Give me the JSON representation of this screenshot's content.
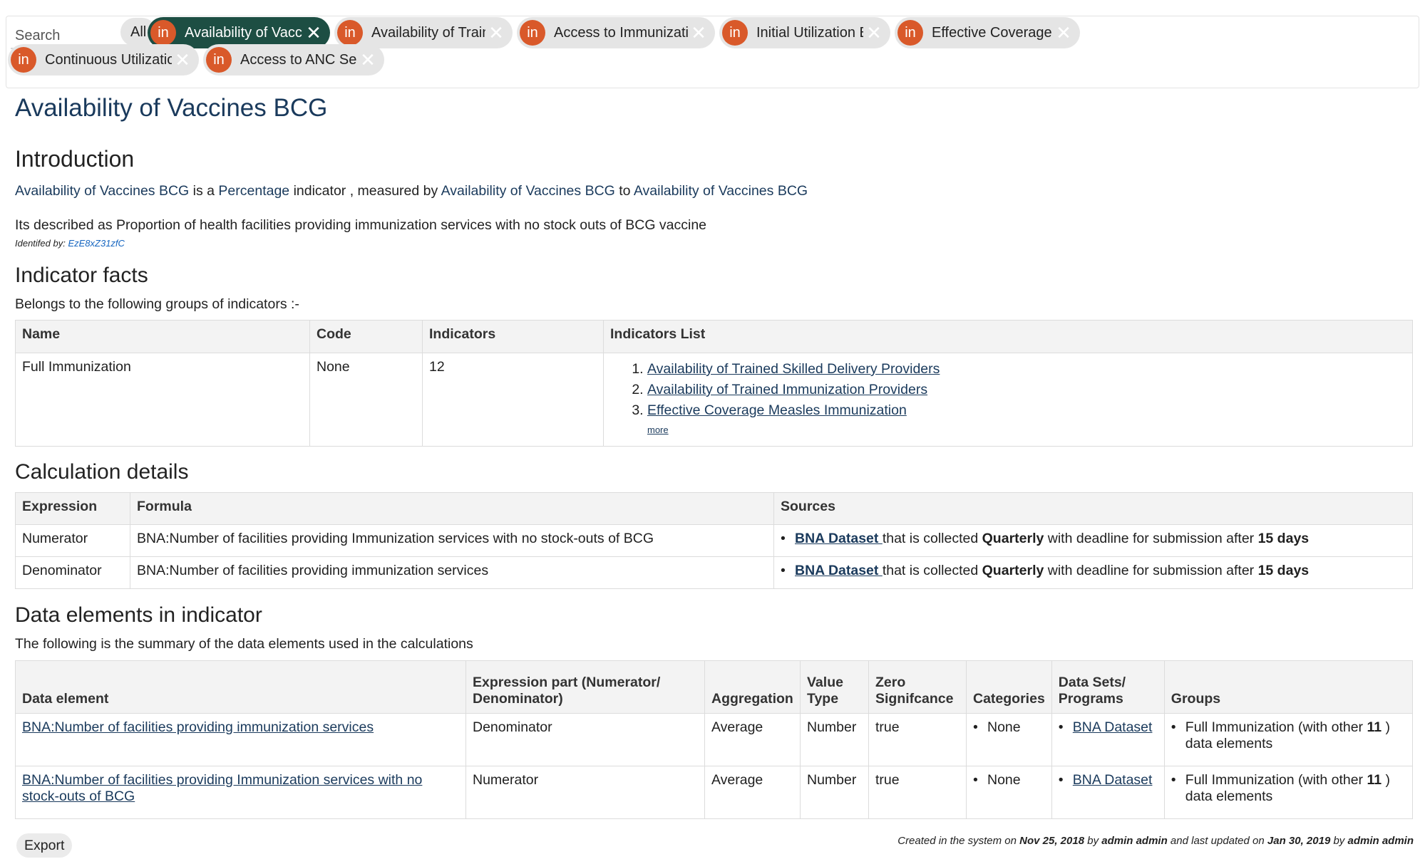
{
  "search": {
    "placeholder": "Search"
  },
  "tabs": {
    "all_label": "All",
    "items": [
      {
        "avatar": "in",
        "label": "Availability of Vaccines ....",
        "active": true
      },
      {
        "avatar": "in",
        "label": "Availability of Trained I...."
      },
      {
        "avatar": "in",
        "label": "Access to Immunization Se...."
      },
      {
        "avatar": "in",
        "label": "Initial Utilization BCG...."
      },
      {
        "avatar": "in",
        "label": "Effective Coverage Full I...."
      },
      {
        "avatar": "in",
        "label": "Continuous Utilization DP...."
      },
      {
        "avatar": "in",
        "label": "Access to ANC Services...."
      }
    ],
    "close_glyph": "✕"
  },
  "page": {
    "title": "Availability of Vaccines BCG"
  },
  "intro": {
    "heading": "Introduction",
    "indicator_name": "Availability of Vaccines BCG",
    "is_a": " is a ",
    "type": "Percentage",
    "measured_by": " indicator , measured by ",
    "numerator": "Availability of Vaccines BCG",
    "to": " to ",
    "denominator": "Availability of Vaccines BCG",
    "description": "Its described as Proportion of health facilities providing immunization services with no stock outs of BCG vaccine",
    "identified_label": "Identifed by: ",
    "identified_code": "EzE8xZ31zfC"
  },
  "facts": {
    "heading": "Indicator facts",
    "subtitle": "Belongs to the following groups of indicators :-",
    "columns": [
      "Name",
      "Code",
      "Indicators",
      "Indicators List"
    ],
    "row": {
      "name": "Full Immunization",
      "code": "None",
      "count": "12",
      "list": [
        "Availability of Trained Skilled Delivery Providers",
        "Availability of Trained Immunization Providers",
        "Effective Coverage Measles Immunization"
      ],
      "more": "more"
    }
  },
  "calc": {
    "heading": "Calculation details",
    "columns": [
      "Expression",
      "Formula",
      "Sources"
    ],
    "rows": [
      {
        "expression": "Numerator",
        "formula": "BNA:Number of facilities providing Immunization services with no stock-outs of BCG",
        "source_link": "BNA Dataset ",
        "collected": "that is collected ",
        "period": "Quarterly",
        "deadline": " with deadline for submission after ",
        "days": "15 days"
      },
      {
        "expression": "Denominator",
        "formula": "BNA:Number of facilities providing immunization services",
        "source_link": "BNA Dataset ",
        "collected": "that is collected ",
        "period": "Quarterly",
        "deadline": " with deadline for submission after ",
        "days": "15 days"
      }
    ]
  },
  "elements": {
    "heading": "Data elements in indicator",
    "subtitle": "The following is the summary of the data elements used in the calculations",
    "columns": [
      "Data element",
      "Expression part (Numerator/ Denominator)",
      "Aggregation",
      "Value Type",
      "Zero Signifcance",
      "Categories",
      "Data Sets/ Programs",
      "Groups"
    ],
    "rows": [
      {
        "element": "BNA:Number of facilities providing immunization services",
        "part": "Denominator",
        "aggregation": "Average",
        "value_type": "Number",
        "zero": "true",
        "category": "None",
        "dataset": "BNA Dataset",
        "group_pre": "Full Immunization (with other ",
        "group_count": "11",
        "group_post": " ) data elements"
      },
      {
        "element": "BNA:Number of facilities providing Immunization services with no stock-outs of BCG",
        "part": "Numerator",
        "aggregation": "Average",
        "value_type": "Number",
        "zero": "true",
        "category": "None",
        "dataset": "BNA Dataset",
        "group_pre": "Full Immunization (with other ",
        "group_count": "11",
        "group_post": " ) data elements"
      }
    ]
  },
  "footer": {
    "export_label": "Export",
    "created_pre": "Created in the system on ",
    "created_date": "Nov 25, 2018",
    "by1": " by ",
    "creator": "admin admin",
    "updated_pre": " and last updated on ",
    "updated_date": "Jan 30, 2019",
    "by2": " by ",
    "updater": "admin admin"
  }
}
